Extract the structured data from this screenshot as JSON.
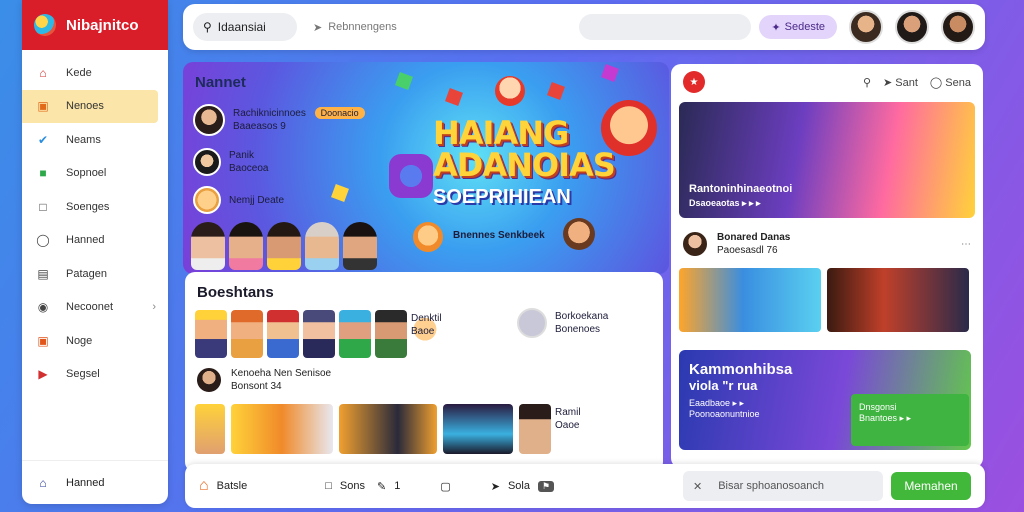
{
  "app": {
    "title": "Nibajnitco"
  },
  "sidebar": {
    "items": [
      {
        "label": "Kede",
        "icon": "home-icon"
      },
      {
        "label": "Nenoes",
        "icon": "grid-icon"
      },
      {
        "label": "Neams",
        "icon": "bird-icon"
      },
      {
        "label": "Sopnoel",
        "icon": "square-icon"
      },
      {
        "label": "Soenges",
        "icon": "chat-icon"
      },
      {
        "label": "Hanned",
        "icon": "bubble-icon"
      },
      {
        "label": "Patagen",
        "icon": "list-icon"
      },
      {
        "label": "Necoonet",
        "icon": "compass-icon"
      },
      {
        "label": "Noge",
        "icon": "box-icon"
      },
      {
        "label": "Segsel",
        "icon": "play-icon"
      }
    ],
    "footer": "Hanned"
  },
  "topbar": {
    "search_value": "Idaansiai",
    "link": "Rebnnengens",
    "button": "Sedeste"
  },
  "hero": {
    "label": "Nannet",
    "users": [
      {
        "name": "Rachiknicinnoes",
        "sub": "Baaeasos 9",
        "badge": "Doonacio"
      },
      {
        "name": "Panik",
        "sub": "Baoceoa"
      },
      {
        "name": "Nemjj Deate",
        "sub": ""
      }
    ],
    "title_line1": "HAIANG",
    "title_line2": "ADANOIAS",
    "subtitle": "SOEPRIHIEAN",
    "tagline": "Bnennes Senkbeek"
  },
  "panel": {
    "title": "Boeshtans",
    "side_user": {
      "name": "Denktil",
      "sub": "Baoe"
    },
    "side_user2": {
      "name": "Borkoekana",
      "sub": "Bonenoes"
    },
    "row2": {
      "name": "Kenoeha Nen Senisoe",
      "sub": "Bonsont 34"
    },
    "row2_right": {
      "name": "Ramil",
      "sub": "Oaoe"
    }
  },
  "right": {
    "head_links": [
      "Sant",
      "Sena"
    ],
    "card1": {
      "title": "Rantoninhinaeotnoi",
      "sub": "Dsaoeaotas ▸ ▸ ▸"
    },
    "user": {
      "name": "Bonared Danas",
      "sub": "Paoesasdl 76"
    },
    "card3": {
      "title": "Kammonhibsa",
      "title2": "viola \"r rua",
      "sub1": "Eaadbaoe ▸ ▸",
      "sub2": "Poonoaonuntnioe",
      "green_text": "Dnsgonsi",
      "green_sub": "Bnantoes ▸ ▸"
    }
  },
  "bottombar": {
    "home": "Batsle",
    "item2": "Sons",
    "item3": "1",
    "item5": "Sola",
    "input": "Bisar sphoanosoanch",
    "button": "Memahen"
  }
}
